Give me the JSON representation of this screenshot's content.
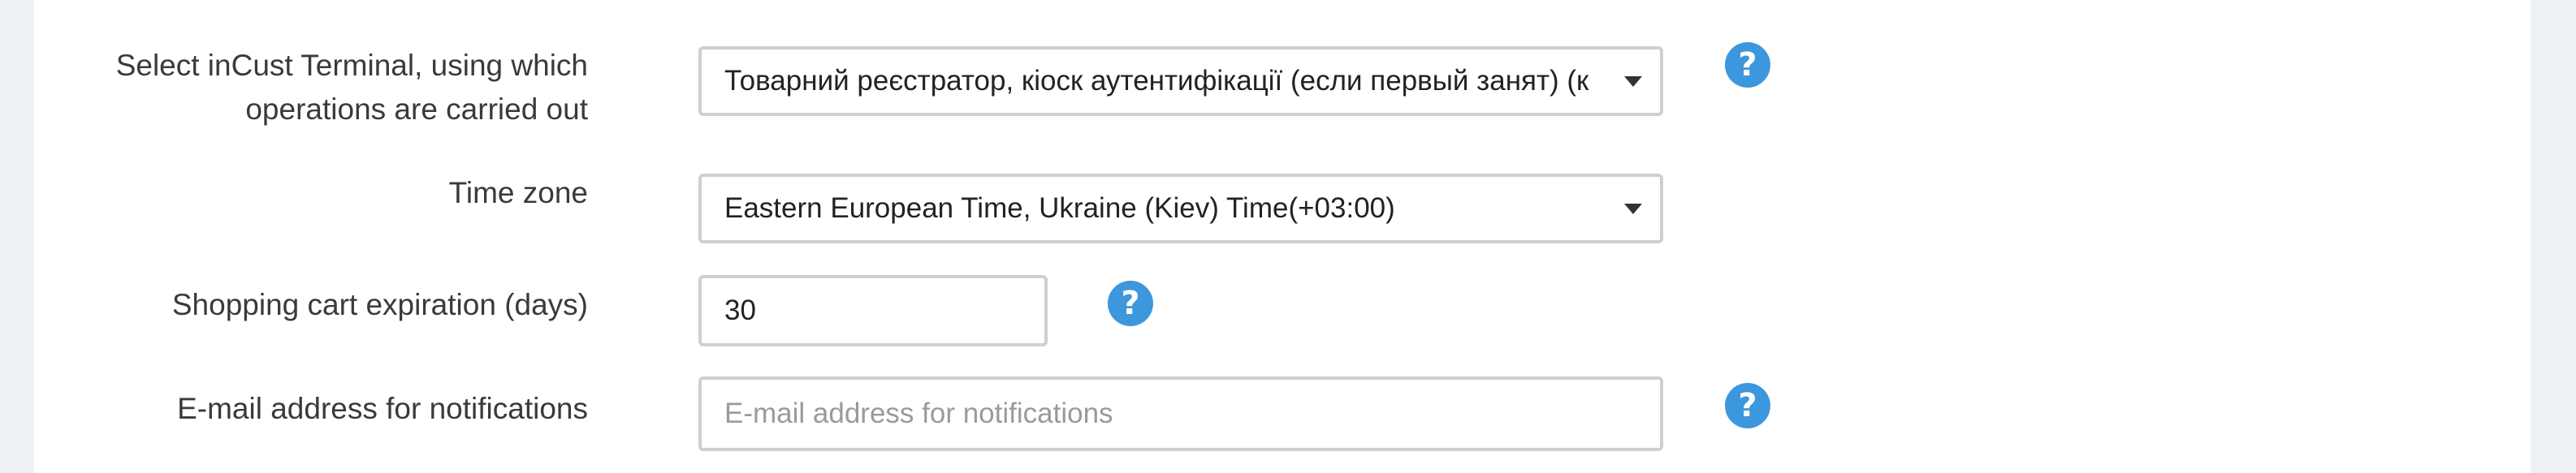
{
  "form": {
    "terminal": {
      "label_line1": "Select inCust Terminal, using which",
      "label_line2": "operations are carried out",
      "value": "Товарний реєстратор, кіоск аутентифікації (если первый занят) (к"
    },
    "timezone": {
      "label": "Time zone",
      "value": "Eastern European Time, Ukraine (Kiev) Time(+03:00)"
    },
    "cart_expiration": {
      "label": "Shopping cart expiration (days)",
      "value": "30"
    },
    "email": {
      "label": "E-mail address for notifications",
      "placeholder": "E-mail address for notifications"
    }
  },
  "icons": {
    "help": "question-circle-icon",
    "dropdown": "caret-down-icon"
  },
  "colors": {
    "page_background": "#edf1f5",
    "panel_background": "#ffffff",
    "help_icon": "#3d97dc",
    "input_border": "#cfcfcf",
    "placeholder_text": "#9a9a9a"
  }
}
